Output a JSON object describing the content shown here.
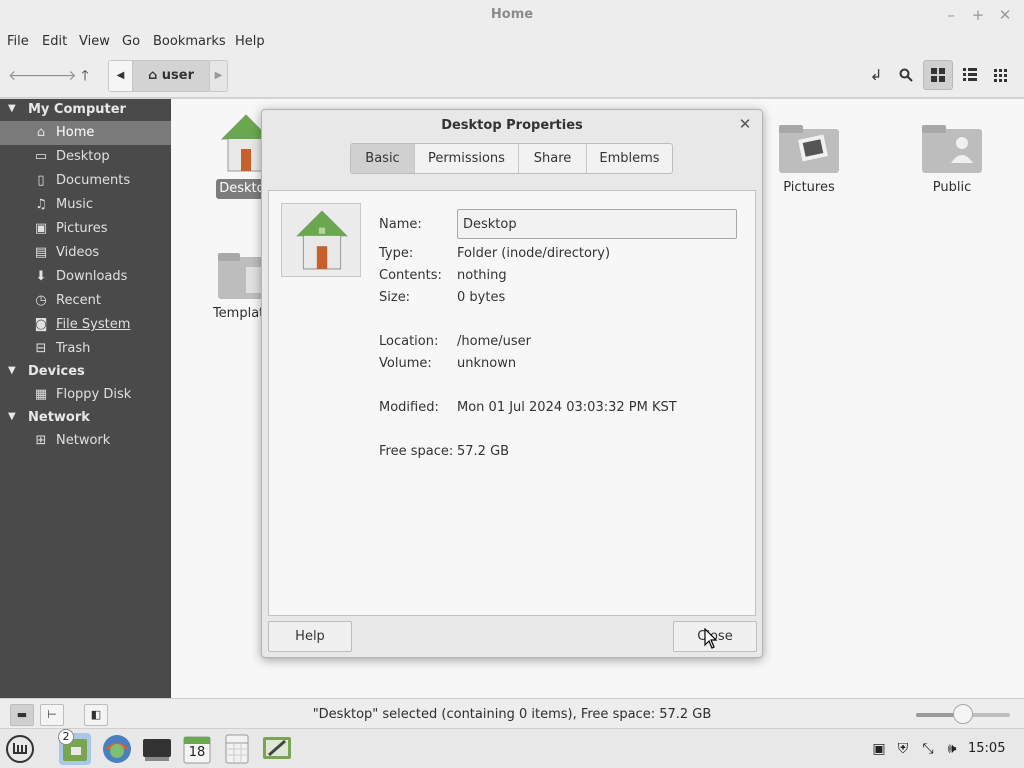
{
  "window": {
    "title": "Home",
    "minimize_icon": "minimize-icon",
    "maximize_icon": "maximize-icon",
    "close_icon": "close-icon"
  },
  "menubar": [
    "File",
    "Edit",
    "View",
    "Go",
    "Bookmarks",
    "Help"
  ],
  "toolbar": {
    "path_segment": "user"
  },
  "sidebar": {
    "sections": [
      {
        "title": "My Computer",
        "items": [
          {
            "label": "Home",
            "icon": "home-icon",
            "active": true
          },
          {
            "label": "Desktop",
            "icon": "desktop-icon"
          },
          {
            "label": "Documents",
            "icon": "documents-icon"
          },
          {
            "label": "Music",
            "icon": "music-icon"
          },
          {
            "label": "Pictures",
            "icon": "pictures-icon"
          },
          {
            "label": "Videos",
            "icon": "videos-icon"
          },
          {
            "label": "Downloads",
            "icon": "downloads-icon"
          },
          {
            "label": "Recent",
            "icon": "recent-icon"
          },
          {
            "label": "File System",
            "icon": "drive-icon"
          },
          {
            "label": "Trash",
            "icon": "trash-icon"
          }
        ]
      },
      {
        "title": "Devices",
        "items": [
          {
            "label": "Floppy Disk",
            "icon": "floppy-icon"
          }
        ]
      },
      {
        "title": "Network",
        "items": [
          {
            "label": "Network",
            "icon": "network-icon"
          }
        ]
      }
    ]
  },
  "files": [
    {
      "label": "Desktop",
      "icon": "home-folder-icon",
      "selected": true
    },
    {
      "label": "Templates",
      "icon": "templates-folder-icon"
    },
    {
      "label": "Pictures",
      "icon": "pictures-folder-icon"
    },
    {
      "label": "Public",
      "icon": "public-folder-icon"
    }
  ],
  "status": {
    "text": "\"Desktop\" selected (containing 0 items), Free space: 57.2 GB",
    "zoom_fraction": 0.5
  },
  "taskbar": {
    "badge": "2",
    "calendar_day": "18",
    "clock": "15:05"
  },
  "dialog": {
    "title": "Desktop Properties",
    "tabs": [
      "Basic",
      "Permissions",
      "Share",
      "Emblems"
    ],
    "active_tab": "Basic",
    "name_label": "Name:",
    "name_value": "Desktop",
    "props": [
      {
        "label": "Type:",
        "value": "Folder (inode/directory)"
      },
      {
        "label": "Contents:",
        "value": "nothing"
      },
      {
        "label": "Size:",
        "value": "0 bytes"
      },
      {
        "label": "Location:",
        "value": "/home/user"
      },
      {
        "label": "Volume:",
        "value": "unknown"
      },
      {
        "label": "Modified:",
        "value": "Mon 01 Jul 2024 03:03:32 PM KST"
      },
      {
        "label": "Free space:",
        "value": "57.2 GB"
      }
    ],
    "help_label": "Help",
    "close_label": "Close"
  },
  "colors": {
    "sidebar_bg": "#4a4a4a",
    "sidebar_active": "#7a7a7a",
    "folder_green": "#6aa84f",
    "door_orange": "#c8602b"
  }
}
